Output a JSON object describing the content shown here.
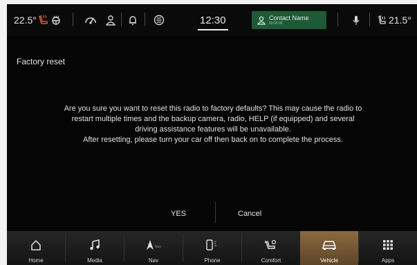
{
  "status_bar": {
    "left_temp": "22.5°",
    "right_temp": "21.5°",
    "clock": "12:30",
    "contact_name": "Contact Name",
    "contact_sub": "00:00:00"
  },
  "dialog": {
    "title": "Factory reset",
    "message_lines": [
      "Are you sure you want to reset this radio to factory defaults? This may cause the radio to",
      "restart multiple times and the backup camera, radio, HELP (if equipped) and several",
      "driving assistance features will be unavailable.",
      "After resetting, please turn your car off then back on to complete the process."
    ],
    "yes_label": "YES",
    "cancel_label": "Cancel"
  },
  "nav": {
    "items": [
      {
        "label": "Home",
        "icon": "home-icon"
      },
      {
        "label": "Media",
        "icon": "music-note-icon"
      },
      {
        "label": "Nav",
        "icon": "navigation-arrow-icon"
      },
      {
        "label": "Phone",
        "icon": "phone-icon"
      },
      {
        "label": "Comfort",
        "icon": "seat-fan-icon"
      },
      {
        "label": "Vehicle",
        "icon": "car-icon"
      },
      {
        "label": "Apps",
        "icon": "apps-grid-icon"
      }
    ],
    "active": "Vehicle"
  },
  "colors": {
    "accent_active": "#8a6a40",
    "contact_chip": "#1e5a36",
    "heated_seat": "#e0503a"
  }
}
